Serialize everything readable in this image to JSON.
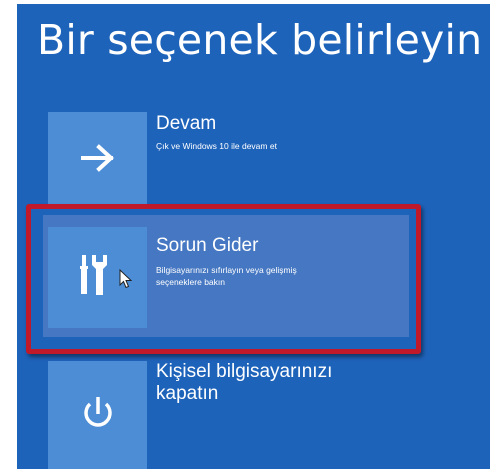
{
  "screen": {
    "title": "Bir seçenek belirleyin",
    "background_color": "#1e63ba",
    "tile_color": "#4c8dd6",
    "highlight_color": "#4577c2",
    "frame_color": "#c0192a"
  },
  "options": [
    {
      "title": "Devam",
      "description": "Çık ve Windows 10 ile devam et",
      "icon": "arrow-right-icon"
    },
    {
      "title": "Sorun Gider",
      "description_line1": "Bilgisayarınızı sıfırlayın veya gelişmiş",
      "description_line2": "seçeneklere bakın",
      "icon": "tools-icon",
      "selected": true
    },
    {
      "title_line1": "Kişisel bilgisayarınızı",
      "title_line2": "kapatın",
      "icon": "power-icon"
    }
  ]
}
